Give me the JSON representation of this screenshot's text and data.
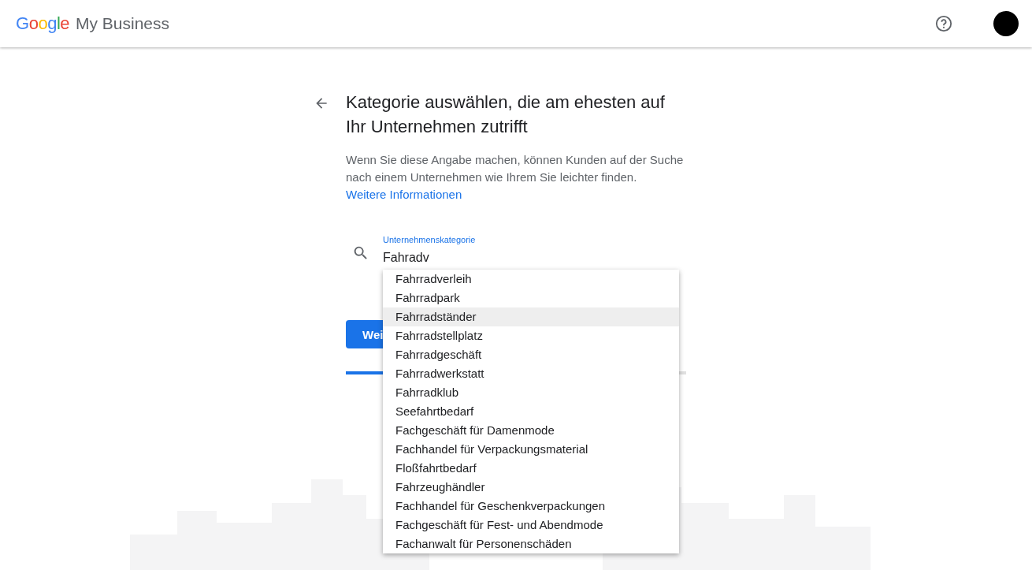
{
  "header": {
    "logo": "Google",
    "product": "My Business"
  },
  "title": "Kategorie auswählen, die am ehesten auf Ihr Unternehmen zutrifft",
  "description": {
    "text": "Wenn Sie diese Angabe machen, können Kunden auf der Suche nach einem Unternehmen wie Ihrem Sie leichter finden.",
    "link": "Weitere Informationen"
  },
  "field": {
    "label": "Unternehmenskategorie",
    "value": "Fahradv"
  },
  "suggestions": [
    {
      "label": "Fahrradverleih",
      "selected": false
    },
    {
      "label": "Fahrradpark",
      "selected": false
    },
    {
      "label": "Fahrradständer",
      "selected": true
    },
    {
      "label": "Fahrradstellplatz",
      "selected": false
    },
    {
      "label": "Fahrradgeschäft",
      "selected": false
    },
    {
      "label": "Fahrradwerkstatt",
      "selected": false
    },
    {
      "label": "Fahrradklub",
      "selected": false
    },
    {
      "label": "Seefahrtbedarf",
      "selected": false
    },
    {
      "label": "Fachgeschäft für Damenmode",
      "selected": false
    },
    {
      "label": "Fachhandel für Verpackungsmaterial",
      "selected": false
    },
    {
      "label": "Floßfahrtbedarf",
      "selected": false
    },
    {
      "label": "Fahrzeughändler",
      "selected": false
    },
    {
      "label": "Fachhandel für Geschenkverpackungen",
      "selected": false
    },
    {
      "label": "Fachgeschäft für Fest- und Abendmode",
      "selected": false
    },
    {
      "label": "Fachanwalt für Personenschäden",
      "selected": false
    }
  ],
  "next_button": "Wei",
  "progress": {
    "level": 0.11
  }
}
